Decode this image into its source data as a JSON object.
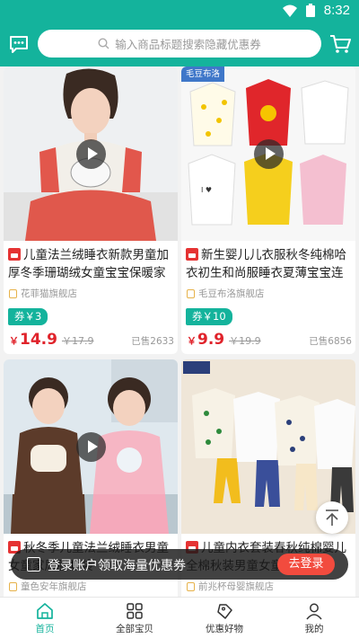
{
  "status_bar": {
    "time": "8:32"
  },
  "header": {
    "search_placeholder": "输入商品标题搜索隐藏优惠券",
    "message_icon": "message-icon",
    "cart_icon": "cart-icon"
  },
  "products": [
    {
      "title": "儿童法兰绒睡衣新款男童加厚冬季珊瑚绒女童宝宝保暖家居服",
      "shop": "花菲猫旗舰店",
      "coupon": "券￥3",
      "price_symbol": "￥",
      "price": "14.9",
      "original_price": "￥17.9",
      "sold": "已售2633",
      "has_video": true
    },
    {
      "title": "新生婴儿儿衣服秋冬纯棉哈衣初生和尚服睡衣夏薄宝宝连体衣",
      "shop": "毛豆布洛旗舰店",
      "shop_tag": "毛豆布洛",
      "coupon": "券￥10",
      "price_symbol": "￥",
      "price": "9.9",
      "original_price": "￥19.9",
      "sold": "已售6856",
      "has_video": true
    },
    {
      "title": "秋冬季儿童法兰绒睡衣男童女童家居服套装",
      "shop": "童色安年旗舰店",
      "has_video": true
    },
    {
      "title": "儿童内衣套装春秋纯棉婴儿全棉秋装男童女童秋衣秋裤",
      "shop": "前兆杯母婴旗舰店",
      "has_video": false
    }
  ],
  "login_banner": {
    "text": "登录账户领取海量优惠券",
    "button": "去登录"
  },
  "nav": [
    {
      "label": "首页",
      "icon": "home-icon",
      "active": true
    },
    {
      "label": "全部宝贝",
      "icon": "grid-icon",
      "active": false
    },
    {
      "label": "优惠好物",
      "icon": "tag-icon",
      "active": false
    },
    {
      "label": "我的",
      "icon": "user-icon",
      "active": false
    }
  ],
  "colors": {
    "brand": "#14b39c",
    "price": "#e0232b",
    "login_button": "#f24b3e"
  }
}
